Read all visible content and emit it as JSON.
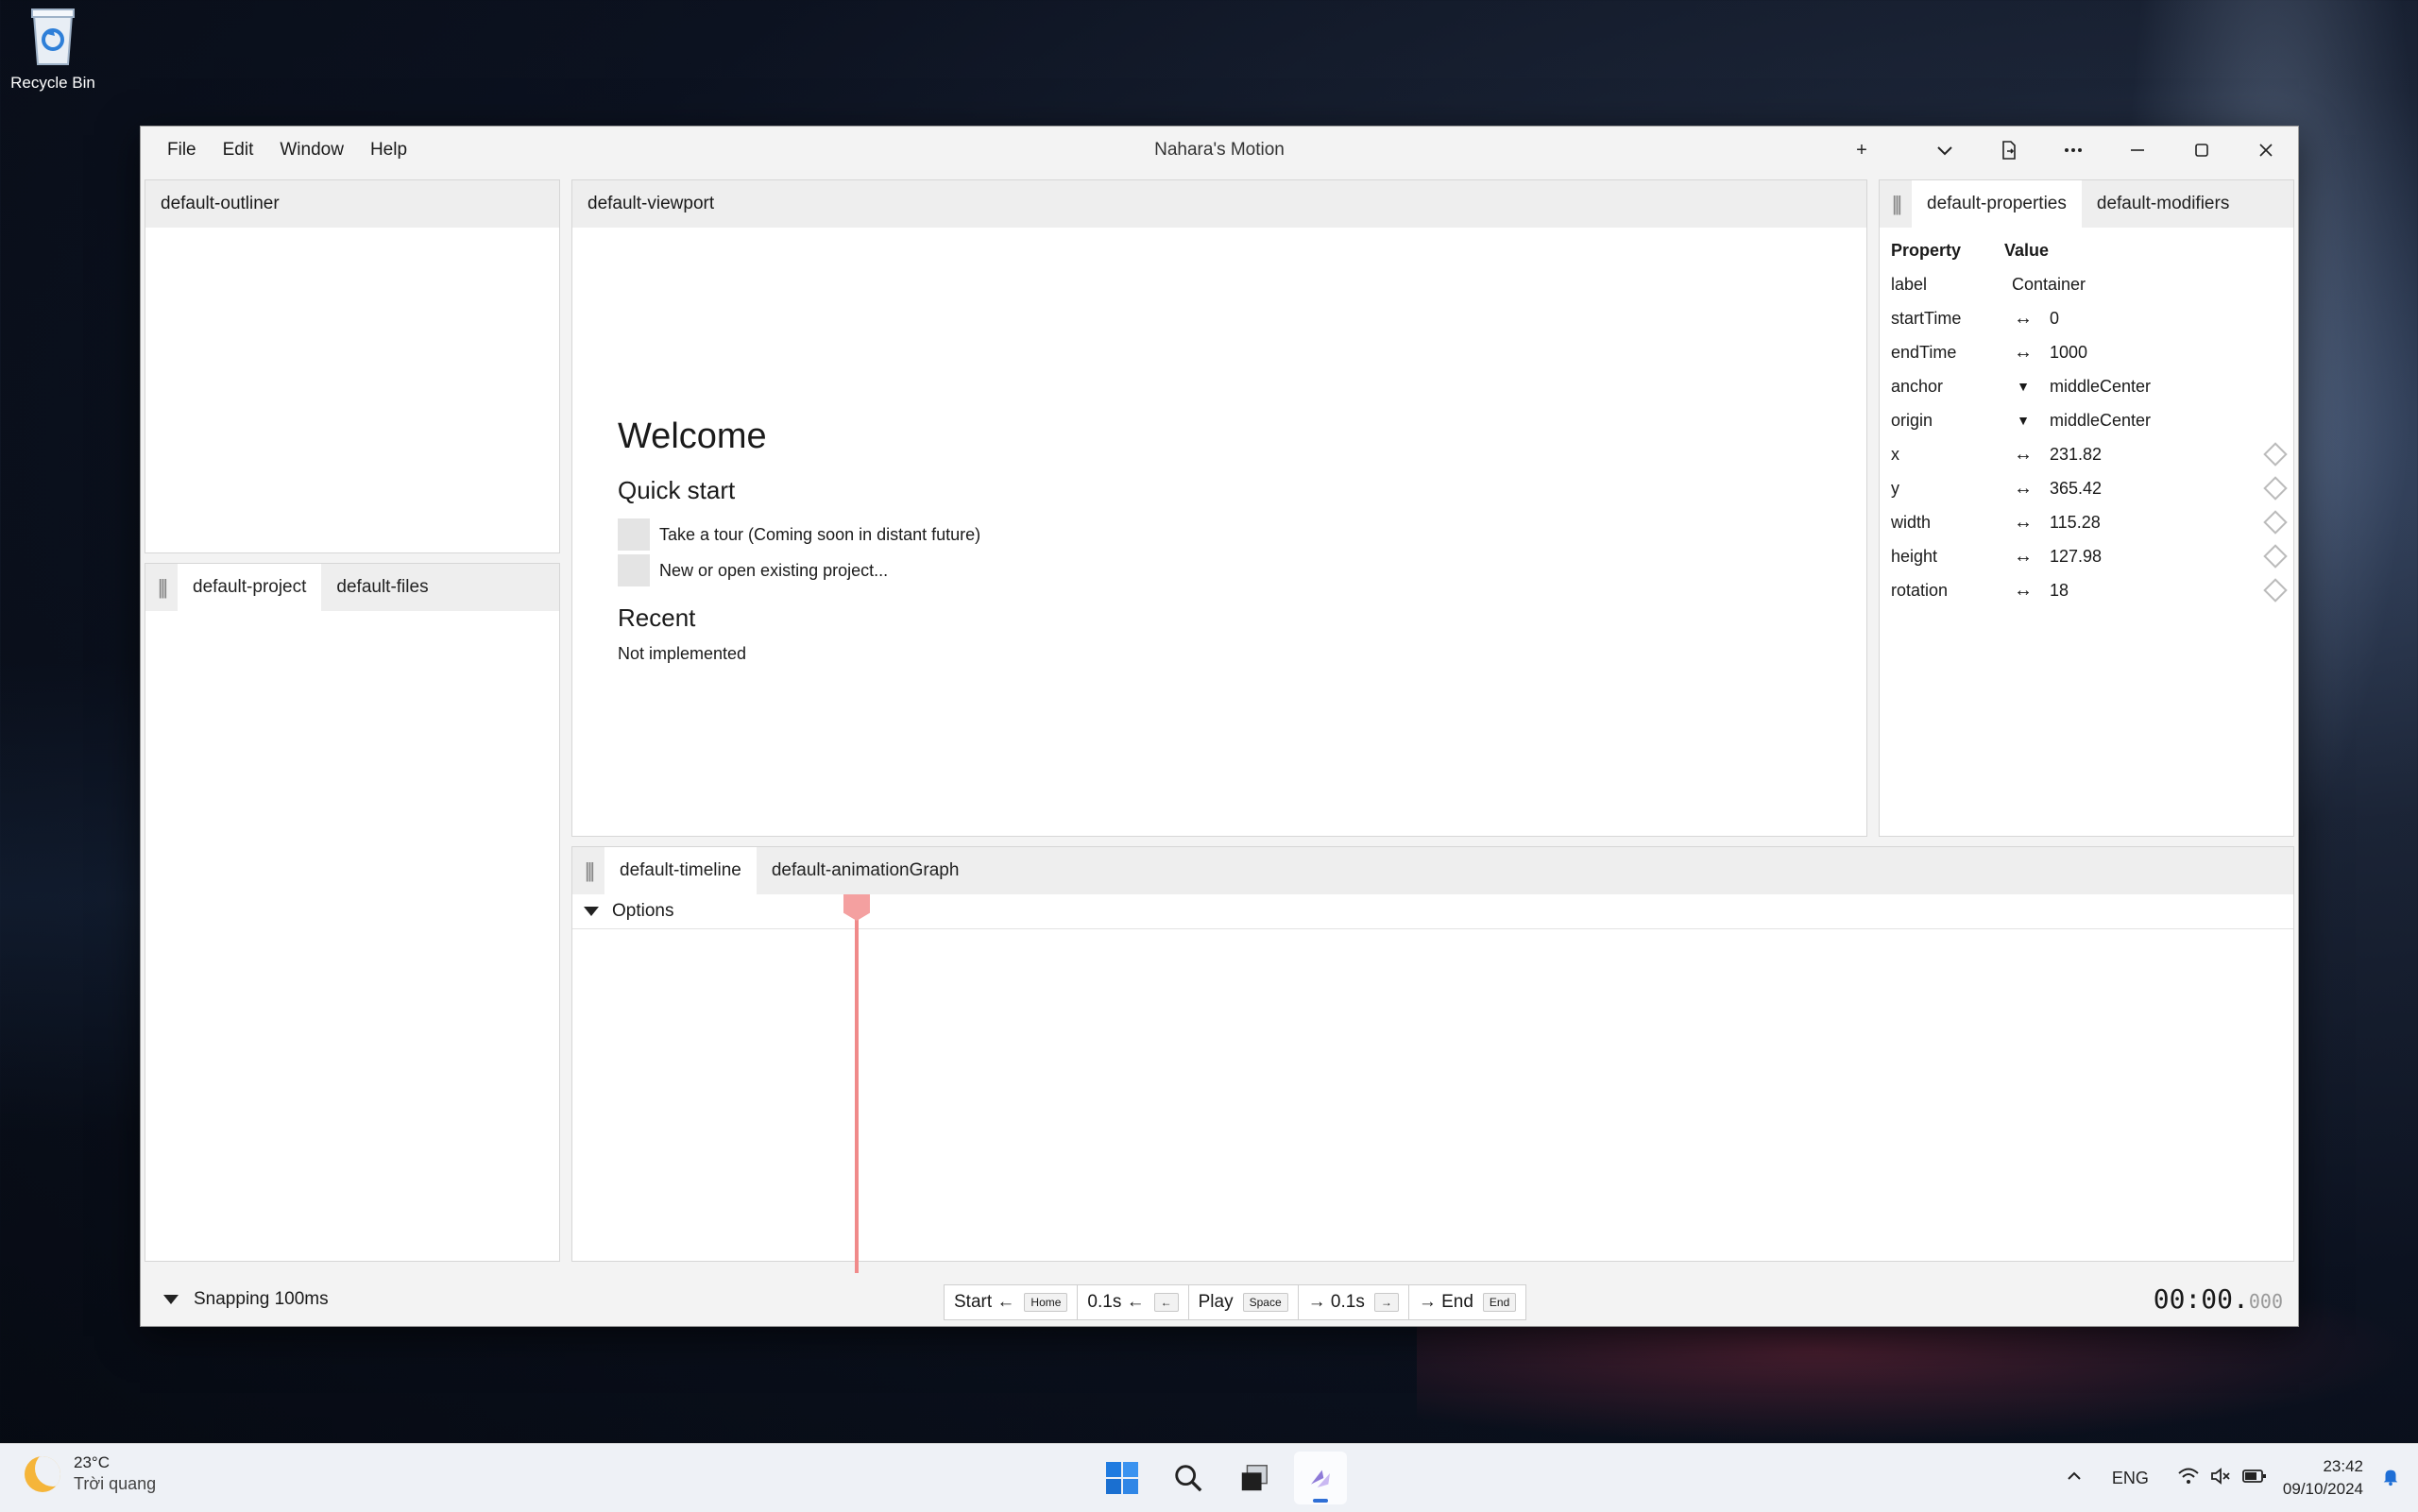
{
  "desktop": {
    "recycle_bin_label": "Recycle Bin"
  },
  "window": {
    "title": "Nahara's Motion",
    "menu": [
      "File",
      "Edit",
      "Window",
      "Help"
    ],
    "plus_label": "+"
  },
  "outliner": {
    "tab": "default-outliner"
  },
  "project_panel": {
    "tabs": [
      "default-project",
      "default-files"
    ]
  },
  "viewport": {
    "tab": "default-viewport",
    "welcome_title": "Welcome",
    "quick_start_title": "Quick start",
    "quick_start_items": [
      "Take a tour (Coming soon in distant future)",
      "New or open existing project..."
    ],
    "recent_title": "Recent",
    "recent_text": "Not implemented"
  },
  "properties_panel": {
    "tabs": [
      "default-properties",
      "default-modifiers"
    ],
    "header_property": "Property",
    "header_value": "Value",
    "rows": [
      {
        "key": "label",
        "value": "Container",
        "icon": "none"
      },
      {
        "key": "startTime",
        "value": "0",
        "icon": "drag-arrows-icon"
      },
      {
        "key": "endTime",
        "value": "1000",
        "icon": "drag-arrows-icon"
      },
      {
        "key": "anchor",
        "value": "middleCenter",
        "icon": "dropdown-icon"
      },
      {
        "key": "origin",
        "value": "middleCenter",
        "icon": "dropdown-icon"
      },
      {
        "key": "x",
        "value": "231.82",
        "icon": "drag-arrows-icon",
        "keyframe": true
      },
      {
        "key": "y",
        "value": "365.42",
        "icon": "drag-arrows-icon",
        "keyframe": true
      },
      {
        "key": "width",
        "value": "115.28",
        "icon": "drag-arrows-icon",
        "keyframe": true
      },
      {
        "key": "height",
        "value": "127.98",
        "icon": "drag-arrows-icon",
        "keyframe": true
      },
      {
        "key": "rotation",
        "value": "18",
        "icon": "drag-arrows-icon",
        "keyframe": true
      }
    ]
  },
  "timeline_panel": {
    "tabs": [
      "default-timeline",
      "default-animationGraph"
    ],
    "options_label": "Options"
  },
  "bottom_bar": {
    "snapping_label": "Snapping 100ms",
    "transport": [
      {
        "label": "Start ←",
        "key": "Home"
      },
      {
        "label": "0.1s ←",
        "key": "←"
      },
      {
        "label": "Play",
        "key": "Space"
      },
      {
        "label": "→ 0.1s",
        "key": "→"
      },
      {
        "label": "→ End",
        "key": "End"
      }
    ],
    "timecode_main": "00:00.",
    "timecode_ms": "000"
  },
  "taskbar": {
    "temperature": "23°C",
    "weather_text": "Trời quang",
    "language": "ENG",
    "time": "23:42",
    "date": "09/10/2024"
  }
}
